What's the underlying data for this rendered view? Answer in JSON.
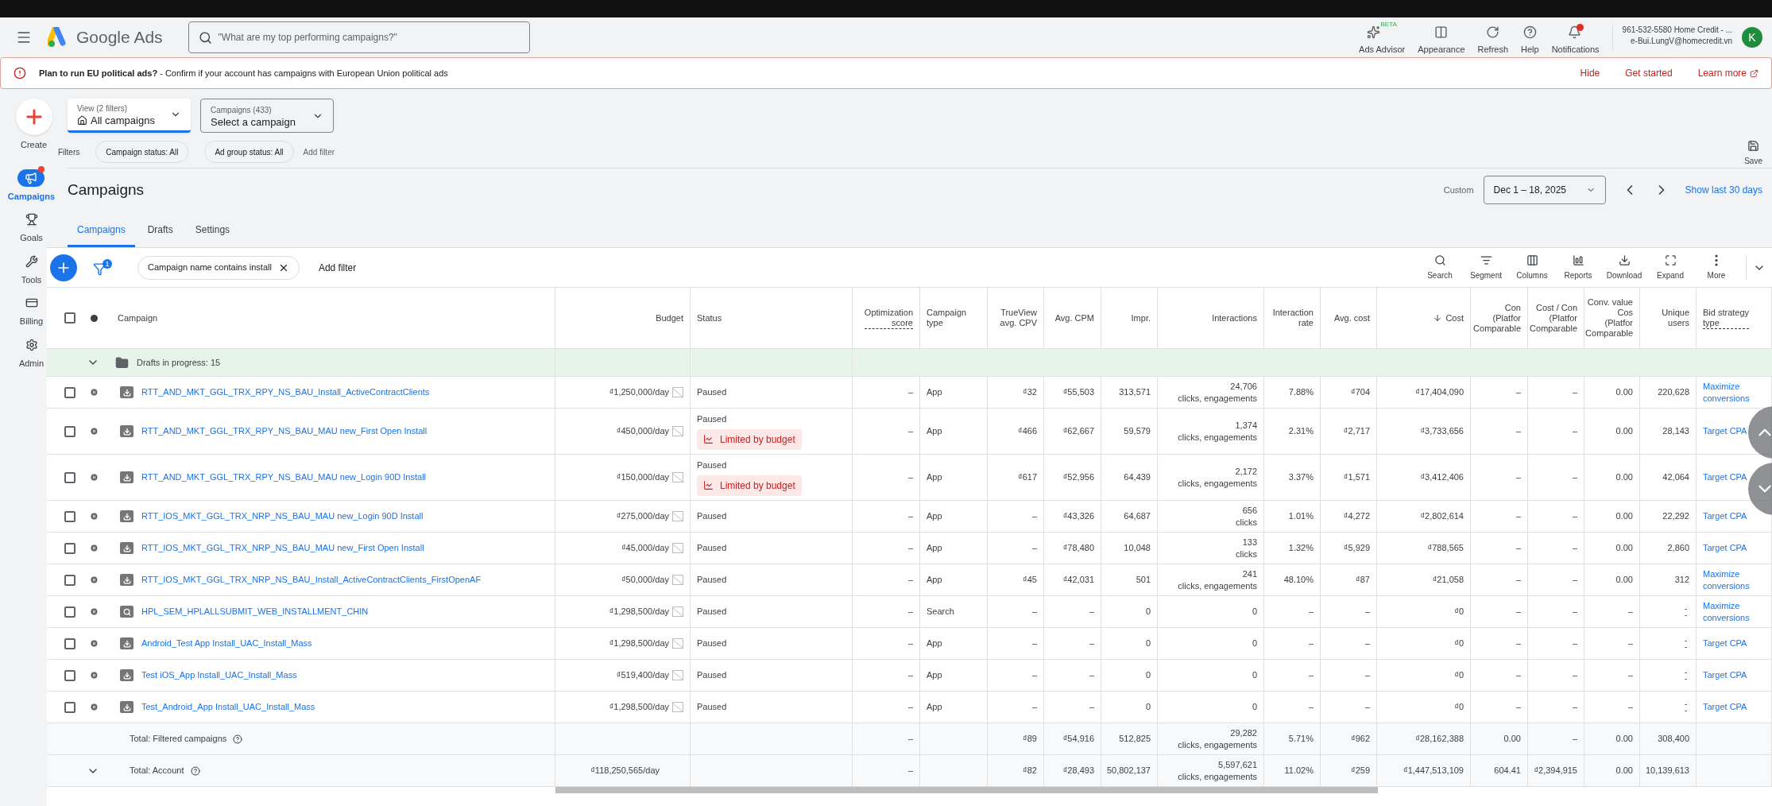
{
  "header": {
    "product": "Google Ads",
    "search_placeholder": "\"What are my top performing campaigns?\"",
    "actions": [
      {
        "kind": "advisor",
        "label": "Ads Advisor",
        "badge": "BETA"
      },
      {
        "kind": "appearance",
        "label": "Appearance"
      },
      {
        "kind": "refresh",
        "label": "Refresh"
      },
      {
        "kind": "help",
        "label": "Help"
      },
      {
        "kind": "notifications",
        "label": "Notifications"
      }
    ],
    "account": {
      "line1": "961-532-5580 Home Credit - ...",
      "line2": "e-Bui.LungV@homecredit.vn",
      "avatar": "K"
    }
  },
  "banner": {
    "text": "**Plan to run EU political ads?** - Confirm if your account has campaigns with European Union political ads",
    "links": [
      "Hide",
      "Get started",
      "Learn more"
    ]
  },
  "sidebar": {
    "items": [
      {
        "kind": "create",
        "label": "Create",
        "selected": false
      },
      {
        "kind": "campaigns",
        "label": "Campaigns",
        "selected": true
      },
      {
        "kind": "goals",
        "label": "Goals",
        "selected": false
      },
      {
        "kind": "tools",
        "label": "Tools",
        "selected": false
      },
      {
        "kind": "billing",
        "label": "Billing",
        "selected": false
      },
      {
        "kind": "admin",
        "label": "Admin",
        "selected": false
      }
    ]
  },
  "view_selector": {
    "caption": "View (2 filters)",
    "value": "All campaigns"
  },
  "campaign_selector": {
    "caption": "Campaigns (433)",
    "value": "Select a campaign"
  },
  "filters": {
    "label": "Filters",
    "chips": [
      "Campaign status: All",
      "Ad group status: All"
    ],
    "add": "Add filter"
  },
  "save": "Save",
  "page_title": "Campaigns",
  "date": {
    "label": "Custom",
    "range": "Dec 1 – 18, 2025",
    "show_last": "Show last 30 days"
  },
  "tabs": [
    {
      "label": "Campaigns",
      "selected": true
    },
    {
      "label": "Drafts",
      "selected": false
    },
    {
      "label": "Settings",
      "selected": false
    }
  ],
  "table_filter": {
    "count": "1",
    "chip": "Campaign name contains install",
    "add": "Add filter"
  },
  "toolbar": [
    {
      "kind": "search",
      "label": "Search"
    },
    {
      "kind": "segment",
      "label": "Segment"
    },
    {
      "kind": "columns",
      "label": "Columns"
    },
    {
      "kind": "reports",
      "label": "Reports"
    },
    {
      "kind": "download",
      "label": "Download"
    },
    {
      "kind": "expand",
      "label": "Expand"
    },
    {
      "kind": "more",
      "label": "More"
    }
  ],
  "table": {
    "all_checked": false,
    "columns": [
      {
        "label": "Campaign",
        "sorted": false,
        "has_definition": false
      },
      {
        "label": "Budget",
        "sorted": false,
        "has_definition": false
      },
      {
        "label": "Status",
        "sorted": false,
        "has_definition": false
      },
      {
        "label": "Optimization\nscore",
        "sorted": false,
        "has_definition": true
      },
      {
        "label": "Campaign\ntype",
        "sorted": false,
        "has_definition": false
      },
      {
        "label": "TrueView\navg. CPV",
        "sorted": false,
        "has_definition": false
      },
      {
        "label": "Avg. CPM",
        "sorted": false,
        "has_definition": false
      },
      {
        "label": "Impr.",
        "sorted": false,
        "has_definition": false
      },
      {
        "label": "Interactions",
        "sorted": false,
        "has_definition": false
      },
      {
        "label": "Interaction\nrate",
        "sorted": false,
        "has_definition": false
      },
      {
        "label": "Avg. cost",
        "sorted": false,
        "has_definition": false
      },
      {
        "label": "Cost",
        "sorted": true,
        "has_definition": false
      },
      {
        "label": "Con\n(Platfor\nComparable",
        "sorted": false,
        "has_definition": false
      },
      {
        "label": "Cost / Con\n(Platfor\nComparable",
        "sorted": false,
        "has_definition": false
      },
      {
        "label": "Conv. value\nCos\n(Platfor\nComparable",
        "sorted": false,
        "has_definition": false
      },
      {
        "label": "Unique\nusers",
        "sorted": false,
        "has_definition": false
      },
      {
        "label": "Bid strategy\ntype",
        "sorted": false,
        "has_definition": true
      }
    ],
    "drafts_row": {
      "label": "Drafts in progress: 15",
      "expanded": true
    },
    "rows": [
      {
        "checked": false,
        "kind": "app",
        "name": "RTT_AND_MKT_GGL_TRX_RPY_NS_BAU_Install_ActiveContractClients",
        "budget": "₫1,250,000/day",
        "status": "Paused",
        "optimization_score": "–",
        "campaign_type": "App",
        "trueview_avg_cpv": "₫32",
        "avg_cpm": "₫55,503",
        "impressions": "313,571",
        "interactions": {
          "value": "24,706",
          "detail": "clicks, engagements"
        },
        "interaction_rate": "7.88%",
        "avg_cost": "₫704",
        "cost": "₫17,404,090",
        "conversions": "–",
        "cost_per_conversion": "–",
        "conv_value_per_cost": "0.00",
        "unique_users": "220,628",
        "bid_strategy": "Maximize conversions"
      },
      {
        "checked": false,
        "kind": "app",
        "name": "RTT_AND_MKT_GGL_TRX_RPY_NS_BAU_MAU new_First Open Install",
        "budget": "₫450,000/day",
        "status": "Paused",
        "limited": "Limited by budget",
        "optimization_score": "–",
        "campaign_type": "App",
        "trueview_avg_cpv": "₫466",
        "avg_cpm": "₫62,667",
        "impressions": "59,579",
        "interactions": {
          "value": "1,374",
          "detail": "clicks, engagements"
        },
        "interaction_rate": "2.31%",
        "avg_cost": "₫2,717",
        "cost": "₫3,733,656",
        "conversions": "–",
        "cost_per_conversion": "–",
        "conv_value_per_cost": "0.00",
        "unique_users": "28,143",
        "bid_strategy": "Target CPA"
      },
      {
        "checked": false,
        "kind": "app",
        "name": "RTT_AND_MKT_GGL_TRX_RPY_NS_BAU_MAU new_Login 90D Install",
        "budget": "₫150,000/day",
        "status": "Paused",
        "limited": "Limited by budget",
        "optimization_score": "–",
        "campaign_type": "App",
        "trueview_avg_cpv": "₫617",
        "avg_cpm": "₫52,956",
        "impressions": "64,439",
        "interactions": {
          "value": "2,172",
          "detail": "clicks, engagements"
        },
        "interaction_rate": "3.37%",
        "avg_cost": "₫1,571",
        "cost": "₫3,412,406",
        "conversions": "–",
        "cost_per_conversion": "–",
        "conv_value_per_cost": "0.00",
        "unique_users": "42,064",
        "bid_strategy": "Target CPA"
      },
      {
        "checked": false,
        "kind": "app",
        "name": "RTT_IOS_MKT_GGL_TRX_NRP_NS_BAU_MAU new_Login 90D Install",
        "budget": "₫275,000/day",
        "status": "Paused",
        "optimization_score": "–",
        "campaign_type": "App",
        "trueview_avg_cpv": "–",
        "avg_cpm": "₫43,326",
        "impressions": "64,687",
        "interactions": {
          "value": "656",
          "detail": "clicks"
        },
        "interaction_rate": "1.01%",
        "avg_cost": "₫4,272",
        "cost": "₫2,802,614",
        "conversions": "–",
        "cost_per_conversion": "–",
        "conv_value_per_cost": "0.00",
        "unique_users": "22,292",
        "bid_strategy": "Target CPA"
      },
      {
        "checked": false,
        "kind": "app",
        "name": "RTT_IOS_MKT_GGL_TRX_NRP_NS_BAU_MAU new_First Open Install",
        "budget": "₫45,000/day",
        "status": "Paused",
        "optimization_score": "–",
        "campaign_type": "App",
        "trueview_avg_cpv": "–",
        "avg_cpm": "₫78,480",
        "impressions": "10,048",
        "interactions": {
          "value": "133",
          "detail": "clicks"
        },
        "interaction_rate": "1.32%",
        "avg_cost": "₫5,929",
        "cost": "₫788,565",
        "conversions": "–",
        "cost_per_conversion": "–",
        "conv_value_per_cost": "0.00",
        "unique_users": "2,860",
        "bid_strategy": "Target CPA"
      },
      {
        "checked": false,
        "kind": "app",
        "name": "RTT_IOS_MKT_GGL_TRX_NRP_NS_BAU_Install_ActiveContractClients_FirstOpenAF",
        "budget": "₫50,000/day",
        "status": "Paused",
        "optimization_score": "–",
        "campaign_type": "App",
        "trueview_avg_cpv": "₫45",
        "avg_cpm": "₫42,031",
        "impressions": "501",
        "interactions": {
          "value": "241",
          "detail": "clicks, engagements"
        },
        "interaction_rate": "48.10%",
        "avg_cost": "₫87",
        "cost": "₫21,058",
        "conversions": "–",
        "cost_per_conversion": "–",
        "conv_value_per_cost": "0.00",
        "unique_users": "312",
        "bid_strategy": "Maximize conversions"
      },
      {
        "checked": false,
        "kind": "search",
        "name": "HPL_SEM_HPLALLSUBMIT_WEB_INSTALLMENT_CHIN",
        "budget": "₫1,298,500/day",
        "status": "Paused",
        "optimization_score": "–",
        "campaign_type": "Search",
        "trueview_avg_cpv": "–",
        "avg_cpm": "–",
        "impressions": "0",
        "interactions": {
          "value": "0"
        },
        "interaction_rate": "–",
        "avg_cost": "–",
        "cost": "₫0",
        "conversions": "–",
        "cost_per_conversion": "–",
        "conv_value_per_cost": "–",
        "unique_users": "--",
        "bid_strategy": "Maximize conversions"
      },
      {
        "checked": false,
        "kind": "app",
        "name": "Android_Test App Install_UAC_Install_Mass",
        "budget": "₫1,298,500/day",
        "status": "Paused",
        "optimization_score": "–",
        "campaign_type": "App",
        "trueview_avg_cpv": "–",
        "avg_cpm": "–",
        "impressions": "0",
        "interactions": {
          "value": "0"
        },
        "interaction_rate": "–",
        "avg_cost": "–",
        "cost": "₫0",
        "conversions": "–",
        "cost_per_conversion": "–",
        "conv_value_per_cost": "–",
        "unique_users": "--",
        "bid_strategy": "Target CPA"
      },
      {
        "checked": false,
        "kind": "app",
        "name": "Test iOS_App Install_UAC_Install_Mass",
        "budget": "₫519,400/day",
        "status": "Paused",
        "optimization_score": "–",
        "campaign_type": "App",
        "trueview_avg_cpv": "–",
        "avg_cpm": "–",
        "impressions": "0",
        "interactions": {
          "value": "0"
        },
        "interaction_rate": "–",
        "avg_cost": "–",
        "cost": "₫0",
        "conversions": "–",
        "cost_per_conversion": "–",
        "conv_value_per_cost": "–",
        "unique_users": "--",
        "bid_strategy": "Target CPA"
      },
      {
        "checked": false,
        "kind": "app",
        "name": "Test_Android_App Install_UAC_Install_Mass",
        "budget": "₫1,298,500/day",
        "status": "Paused",
        "optimization_score": "–",
        "campaign_type": "App",
        "trueview_avg_cpv": "–",
        "avg_cpm": "–",
        "impressions": "0",
        "interactions": {
          "value": "0"
        },
        "interaction_rate": "–",
        "avg_cost": "–",
        "cost": "₫0",
        "conversions": "–",
        "cost_per_conversion": "–",
        "conv_value_per_cost": "–",
        "unique_users": "--",
        "bid_strategy": "Target CPA"
      }
    ],
    "totals": [
      {
        "label": "Total: Filtered campaigns",
        "expanded": false,
        "optimization_score": "–",
        "trueview_avg_cpv": "₫89",
        "avg_cpm": "₫54,916",
        "impressions": "512,825",
        "interactions": {
          "value": "29,282",
          "detail": "clicks, engagements"
        },
        "interaction_rate": "5.71%",
        "avg_cost": "₫962",
        "cost": "₫28,162,388",
        "conversions": "0.00",
        "cost_per_conversion": "–",
        "conv_value_per_cost": "0.00",
        "unique_users": "308,400"
      },
      {
        "label": "Total: Account",
        "expanded": true,
        "budget": "₫118,250,565/day",
        "optimization_score": "–",
        "trueview_avg_cpv": "₫82",
        "avg_cpm": "₫28,493",
        "impressions": "50,802,137",
        "interactions": {
          "value": "5,597,621",
          "detail": "clicks, engagements"
        },
        "interaction_rate": "11.02%",
        "avg_cost": "₫259",
        "cost": "₫1,447,513,109",
        "conversions": "604.41",
        "cost_per_conversion": "₫2,394,915",
        "conv_value_per_cost": "0.00",
        "unique_users": "10,139,613"
      }
    ]
  }
}
